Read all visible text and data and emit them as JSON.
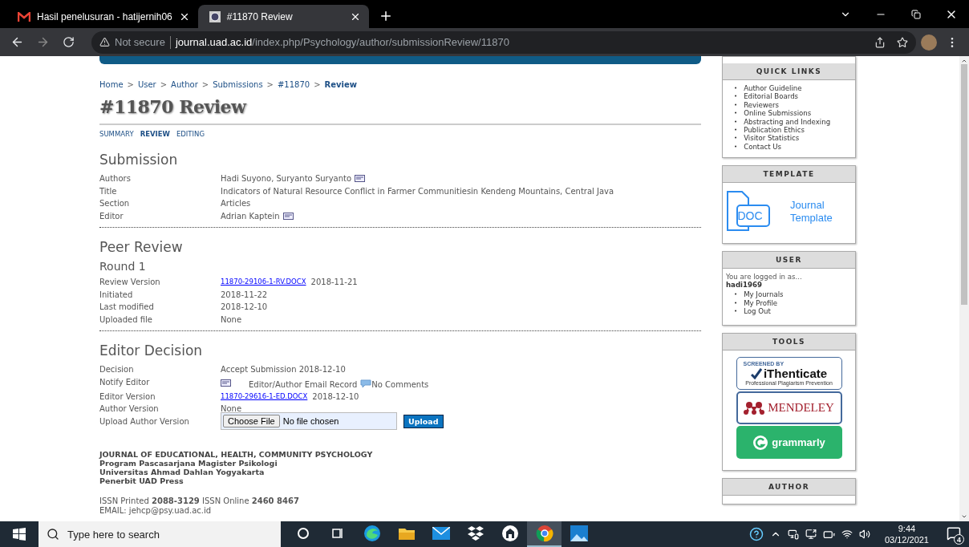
{
  "browser": {
    "tabs": [
      {
        "title": "Hasil penelusuran - hatijernih06",
        "selected": false
      },
      {
        "title": "#11870 Review",
        "selected": true
      }
    ],
    "security": "Not secure",
    "host": "journal.uad.ac.id",
    "path": "/index.php/Psychology/author/submissionReview/11870"
  },
  "breadcrumb": {
    "separator": ">",
    "items": [
      {
        "label": "Home",
        "current": false
      },
      {
        "label": "User",
        "current": false
      },
      {
        "label": "Author",
        "current": false
      },
      {
        "label": "Submissions",
        "current": false
      },
      {
        "label": "#11870",
        "current": false
      },
      {
        "label": "Review",
        "current": true
      }
    ]
  },
  "title": "#11870 Review",
  "subtabs": [
    {
      "label": "SUMMARY",
      "selected": false
    },
    {
      "label": "REVIEW",
      "selected": true
    },
    {
      "label": "EDITING",
      "selected": false
    }
  ],
  "sections": [
    {
      "heading": "Submission",
      "rows": [
        {
          "kind": "text",
          "label": "Authors",
          "value": "Hadi Suyono, Suryanto Suryanto",
          "email_icon": true
        },
        {
          "kind": "text",
          "label": "Title",
          "value": "Indicators of Natural Resource Conflict in Farmer Communitiesin Kendeng Mountains, Central Java",
          "email_icon": false
        },
        {
          "kind": "text",
          "label": "Section",
          "value": "Articles",
          "email_icon": false
        },
        {
          "kind": "text",
          "label": "Editor",
          "value": "Adrian Kaptein",
          "email_icon": true
        }
      ]
    },
    {
      "heading": "Peer Review",
      "subheading": "Round 1",
      "rows": [
        {
          "kind": "file",
          "label": "Review Version",
          "file": "11870-29106-1-RV.DOCX",
          "date": "2018-11-21"
        },
        {
          "kind": "text",
          "label": "Initiated",
          "value": "2018-11-22",
          "email_icon": false
        },
        {
          "kind": "text",
          "label": "Last modified",
          "value": "2018-12-10",
          "email_icon": false
        },
        {
          "kind": "text",
          "label": "Uploaded file",
          "value": "None",
          "email_icon": false
        }
      ]
    },
    {
      "heading": "Editor Decision",
      "rows": [
        {
          "kind": "text",
          "label": "Decision",
          "value": "Accept Submission 2018-12-10",
          "email_icon": false
        },
        {
          "kind": "notify",
          "label": "Notify Editor",
          "value": "Editor/Author Email Record",
          "comment": "No Comments"
        },
        {
          "kind": "file",
          "label": "Editor Version",
          "file": "11870-29616-1-ED.DOCX",
          "date": "2018-12-10"
        },
        {
          "kind": "text",
          "label": "Author Version",
          "value": "None",
          "email_icon": false
        },
        {
          "kind": "upload",
          "label": "Upload Author Version",
          "button": "Choose File",
          "status": "No file chosen",
          "submit": "Upload"
        }
      ]
    }
  ],
  "footer": {
    "lines": [
      "JOURNAL OF EDUCATIONAL, HEALTH, COMMUNITY PSYCHOLOGY",
      "Program Pascasarjana Magister Psikologi",
      "Universitas Ahmad Dahlan Yogyakarta",
      "Penerbit UAD Press"
    ],
    "issn": "ISSN Printed **2088-3129** ISSN Online **2460 8467**",
    "email": "EMAIL: jehcp@psy.uad.ac.id"
  },
  "sidebar": [
    {
      "kind": "links",
      "title": "QUICK LINKS",
      "bullet": "•",
      "items": [
        "Author Guideline",
        "Editorial Boards",
        "Reviewers",
        "Online Submissions",
        "Abstracting and Indexing",
        "Publication Ethics",
        "Visitor Statistics",
        "Contact Us"
      ]
    },
    {
      "kind": "template",
      "title": "TEMPLATE",
      "badge": "DOC",
      "lines": [
        "Journal",
        "Template"
      ]
    },
    {
      "kind": "user",
      "title": "USER",
      "intro": "You are logged in as...",
      "username": "hadi1969",
      "bullet": "•",
      "items": [
        "My Journals",
        "My Profile",
        "Log Out"
      ]
    },
    {
      "kind": "tools",
      "title": "TOOLS",
      "logos": [
        {
          "kind": "ithenticate",
          "caption": "SCREENED BY",
          "name": "iThenticate",
          "tagline": "Professional Plagiarism Prevention"
        },
        {
          "kind": "mendeley",
          "name": "MENDELEY"
        },
        {
          "kind": "grammarly",
          "name": "grammarly"
        }
      ]
    },
    {
      "kind": "header",
      "title": "AUTHOR"
    }
  ],
  "taskbar": {
    "search": {
      "placeholder": "Type here to search"
    },
    "apps": [
      {
        "kind": "cortana",
        "active": false
      },
      {
        "kind": "taskview",
        "active": false
      },
      {
        "kind": "edge",
        "active": false
      },
      {
        "kind": "folder",
        "active": false
      },
      {
        "kind": "mail",
        "active": false
      },
      {
        "kind": "dropbox",
        "active": false
      },
      {
        "kind": "app",
        "active": false
      },
      {
        "kind": "chrome",
        "active": true
      },
      {
        "kind": "photos",
        "active": false
      }
    ],
    "time": "9:44",
    "date": "03/12/2021",
    "notifications": "4"
  }
}
